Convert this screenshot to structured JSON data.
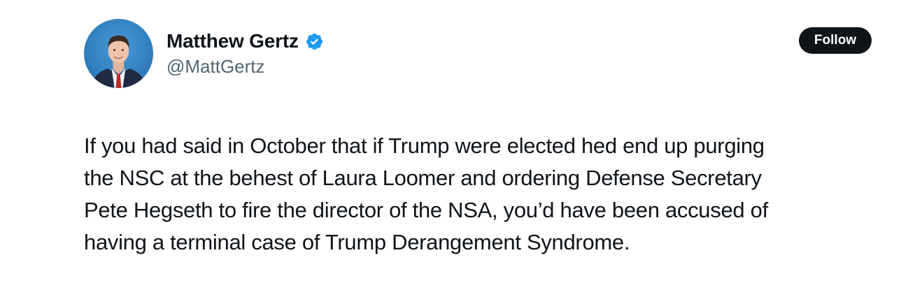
{
  "author": {
    "display_name": "Matthew Gertz",
    "handle": "@MattGertz",
    "verified": true,
    "avatar_icon": "profile-photo",
    "verified_icon": "verified-badge-icon",
    "verified_color": "#1d9bf0"
  },
  "actions": {
    "follow_label": "Follow"
  },
  "tweet": {
    "lines": [
      "If you had said in October that if Trump were elected hed end up purging",
      "the NSC at the behest of Laura Loomer and ordering Defense Secretary",
      "Pete Hegseth to fire the director of the NSA, you’d have been accused of",
      "having a terminal case of Trump Derangement Syndrome."
    ]
  },
  "colors": {
    "text_primary": "#0f1419",
    "text_secondary": "#536471",
    "button_bg": "#0f1419",
    "button_text": "#ffffff",
    "avatar_bg": "#2f7fc1"
  }
}
